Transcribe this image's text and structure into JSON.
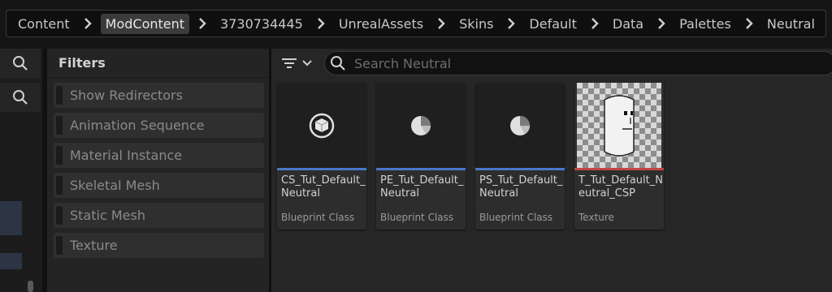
{
  "breadcrumb": {
    "items": [
      "Content",
      "ModContent",
      "3730734445",
      "UnrealAssets",
      "Skins",
      "Default",
      "Data",
      "Palettes",
      "Neutral"
    ],
    "active_index": 1
  },
  "filters": {
    "title": "Filters",
    "items": [
      "Show Redirectors",
      "Animation Sequence",
      "Material Instance",
      "Skeletal Mesh",
      "Static Mesh",
      "Texture"
    ]
  },
  "search": {
    "placeholder": "Search Neutral",
    "value": ""
  },
  "assets": [
    {
      "name": "CS_Tut_Default_Neutral",
      "type": "Blueprint Class",
      "icon": "cube-sphere-icon",
      "stripe_color": "#4a77c9"
    },
    {
      "name": "PE_Tut_Default_Neutral",
      "type": "Blueprint Class",
      "icon": "pie-chart-icon",
      "stripe_color": "#4a77c9"
    },
    {
      "name": "PS_Tut_Default_Neutral",
      "type": "Blueprint Class",
      "icon": "pie-chart-icon",
      "stripe_color": "#4a77c9"
    },
    {
      "name": "T_Tut_Default_Neutral_CSP",
      "type": "Texture",
      "icon": "texture-face-preview",
      "stripe_color": "#c24545"
    }
  ],
  "colors": {
    "accent_blueprint": "#4a77c9",
    "accent_texture": "#c24545"
  }
}
